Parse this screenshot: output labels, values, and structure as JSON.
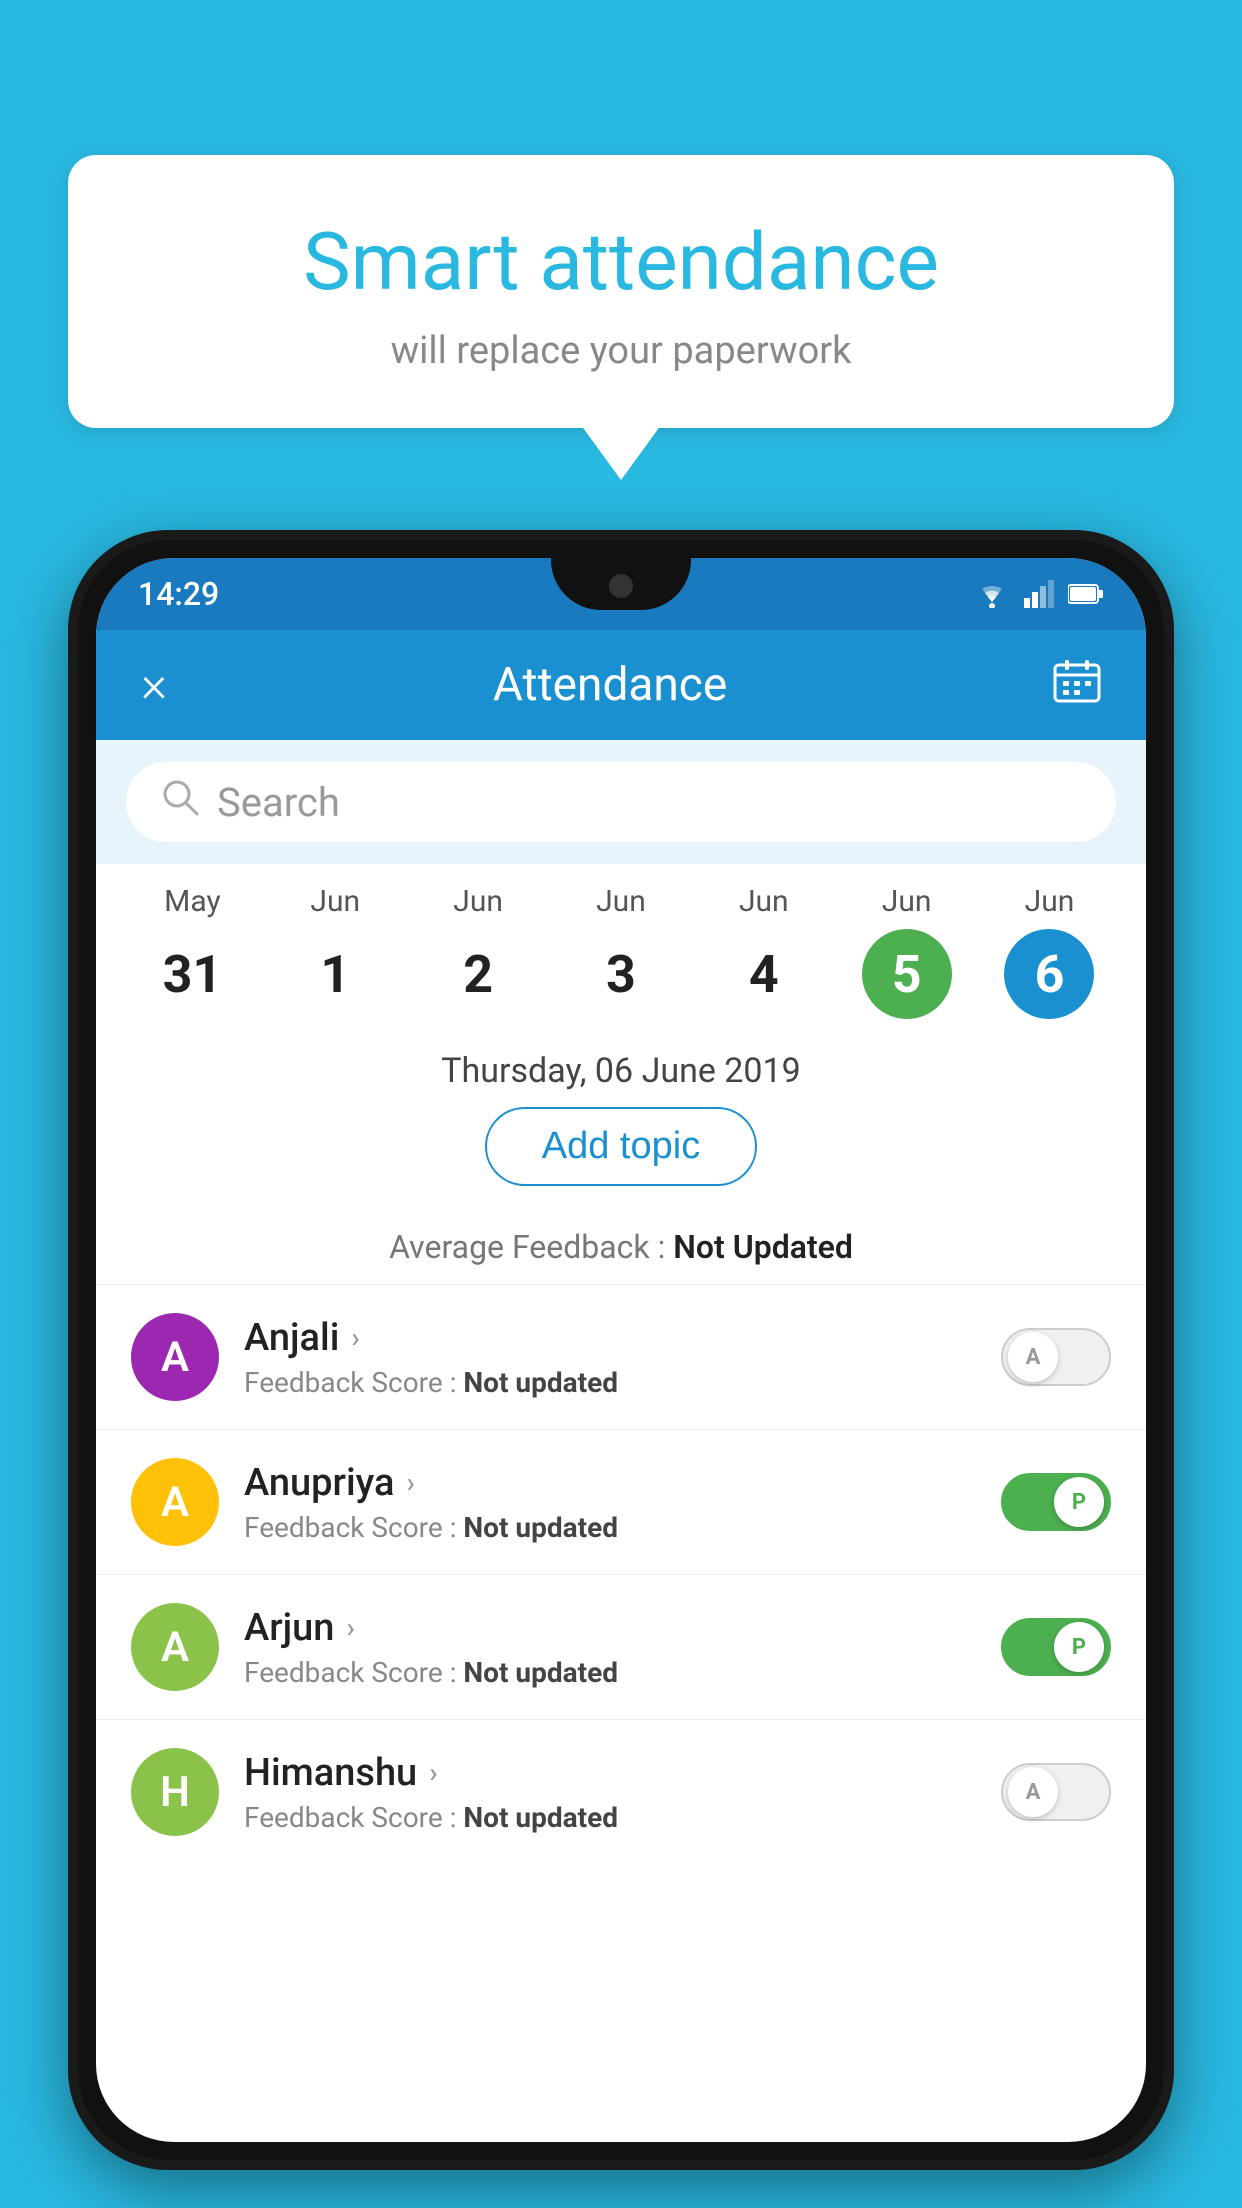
{
  "background_color": "#29B8E0",
  "bubble": {
    "title": "Smart attendance",
    "subtitle": "will replace your paperwork"
  },
  "status_bar": {
    "time": "14:29",
    "wifi_icon": "wifi",
    "signal_icon": "signal",
    "battery_icon": "battery"
  },
  "header": {
    "close_label": "×",
    "title": "Attendance",
    "calendar_icon": "calendar"
  },
  "search": {
    "placeholder": "Search"
  },
  "calendar": {
    "days": [
      {
        "month": "May",
        "date": "31",
        "style": "normal"
      },
      {
        "month": "Jun",
        "date": "1",
        "style": "normal"
      },
      {
        "month": "Jun",
        "date": "2",
        "style": "normal"
      },
      {
        "month": "Jun",
        "date": "3",
        "style": "normal"
      },
      {
        "month": "Jun",
        "date": "4",
        "style": "normal"
      },
      {
        "month": "Jun",
        "date": "5",
        "style": "today"
      },
      {
        "month": "Jun",
        "date": "6",
        "style": "selected"
      }
    ],
    "selected_date": "Thursday, 06 June 2019"
  },
  "add_topic_label": "Add topic",
  "avg_feedback_label": "Average Feedback :",
  "avg_feedback_value": "Not Updated",
  "students": [
    {
      "name": "Anjali",
      "initial": "A",
      "avatar_color": "#9C27B0",
      "feedback_label": "Feedback Score :",
      "feedback_value": "Not updated",
      "attendance": "absent",
      "toggle_label": "A"
    },
    {
      "name": "Anupriya",
      "initial": "A",
      "avatar_color": "#FFC107",
      "feedback_label": "Feedback Score :",
      "feedback_value": "Not updated",
      "attendance": "present",
      "toggle_label": "P"
    },
    {
      "name": "Arjun",
      "initial": "A",
      "avatar_color": "#8BC34A",
      "feedback_label": "Feedback Score :",
      "feedback_value": "Not updated",
      "attendance": "present",
      "toggle_label": "P"
    },
    {
      "name": "Himanshu",
      "initial": "H",
      "avatar_color": "#8BC34A",
      "feedback_label": "Feedback Score :",
      "feedback_value": "Not updated",
      "attendance": "absent",
      "toggle_label": "A"
    }
  ]
}
